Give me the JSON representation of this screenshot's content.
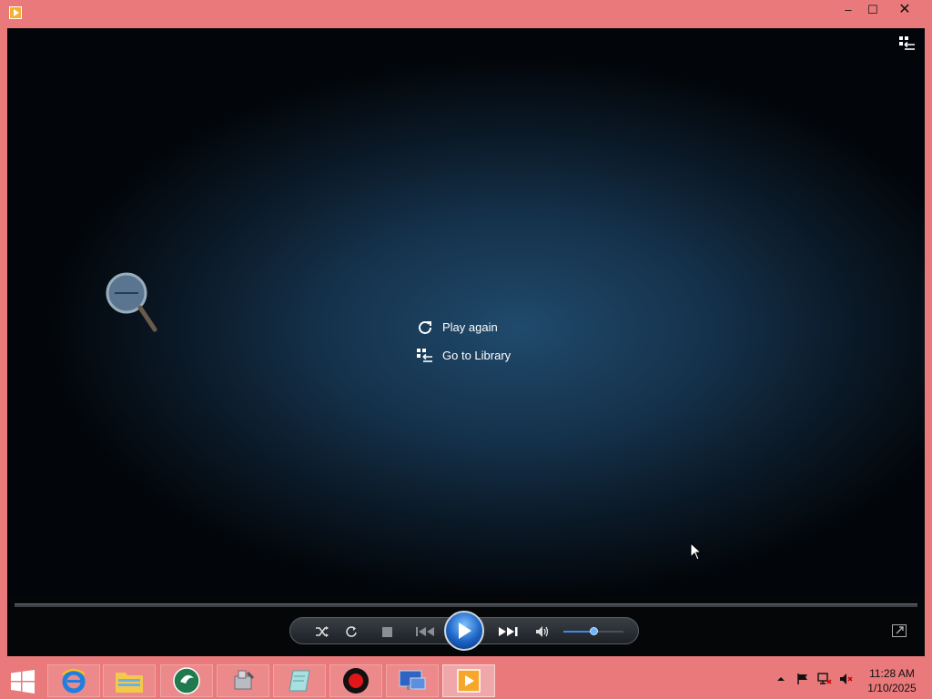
{
  "window": {
    "controls": {
      "minimize": "–",
      "maximize": "☐",
      "close": "✕"
    }
  },
  "player": {
    "menu": [
      {
        "id": "play-again",
        "label": "Play again",
        "icon": "replay-icon"
      },
      {
        "id": "go-to-library",
        "label": "Go to Library",
        "icon": "library-icon"
      }
    ],
    "controls": {
      "shuffle": "shuffle-icon",
      "repeat": "repeat-icon",
      "stop": "stop-icon",
      "previous": "previous-icon",
      "play": "play-icon",
      "next": "next-icon",
      "mute": "speaker-icon",
      "volume_level": 0.5
    }
  },
  "taskbar": {
    "apps": [
      "internet-explorer-icon",
      "file-explorer-icon",
      "green-app-icon",
      "tools-app-icon",
      "notes-app-icon",
      "record-app-icon",
      "remote-desktop-icon",
      "media-player-icon"
    ],
    "clock": {
      "time": "11:28 AM",
      "date": "1/10/2025"
    },
    "colors": {
      "accent": "#e9797b"
    }
  }
}
